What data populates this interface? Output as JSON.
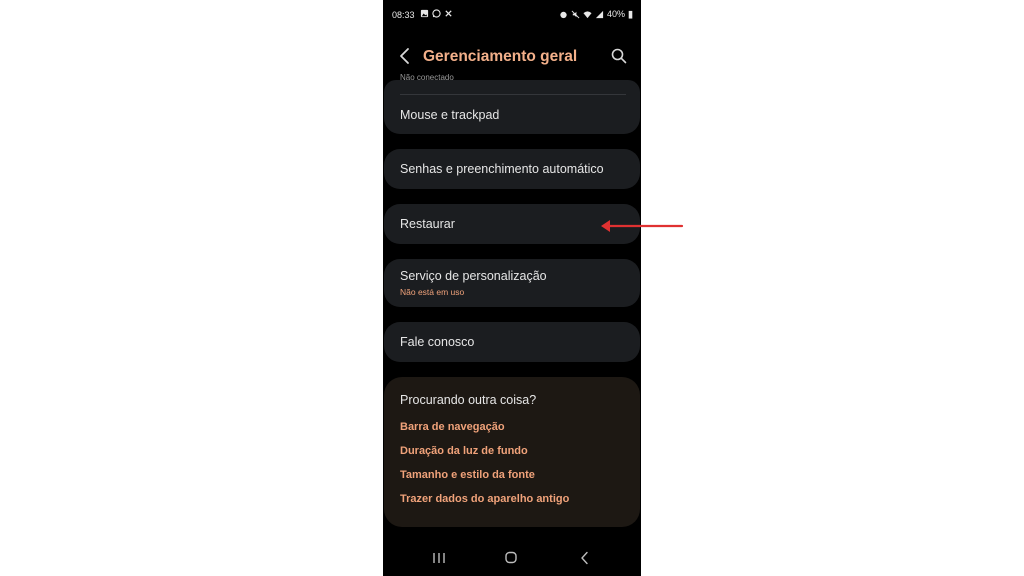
{
  "status_bar": {
    "time": "08:33",
    "battery": "40%"
  },
  "header": {
    "title": "Gerenciamento geral",
    "back_icon": "chevron-left-icon",
    "search_icon": "search-icon"
  },
  "list": {
    "partial_item_subtitle": "Não conectado",
    "items": [
      {
        "label": "Mouse e trackpad"
      },
      {
        "label": "Senhas e preenchimento automático"
      },
      {
        "label": "Restaurar"
      },
      {
        "label": "Serviço de personalização",
        "subtitle": "Não está em uso"
      },
      {
        "label": "Fale conosco"
      }
    ]
  },
  "suggestions": {
    "title": "Procurando outra coisa?",
    "links": [
      "Barra de navegação",
      "Duração da luz de fundo",
      "Tamanho e estilo da fonte",
      "Trazer dados do aparelho antigo"
    ]
  },
  "colors": {
    "accent": "#f3b08a",
    "link": "#f0a27a",
    "card_bg": "#1b1d20",
    "suggest_bg": "#1d1813",
    "annotation_arrow": "#e03131"
  },
  "navbar": {
    "recents_icon": "recents-icon",
    "home_icon": "home-icon",
    "back_icon": "back-icon"
  }
}
